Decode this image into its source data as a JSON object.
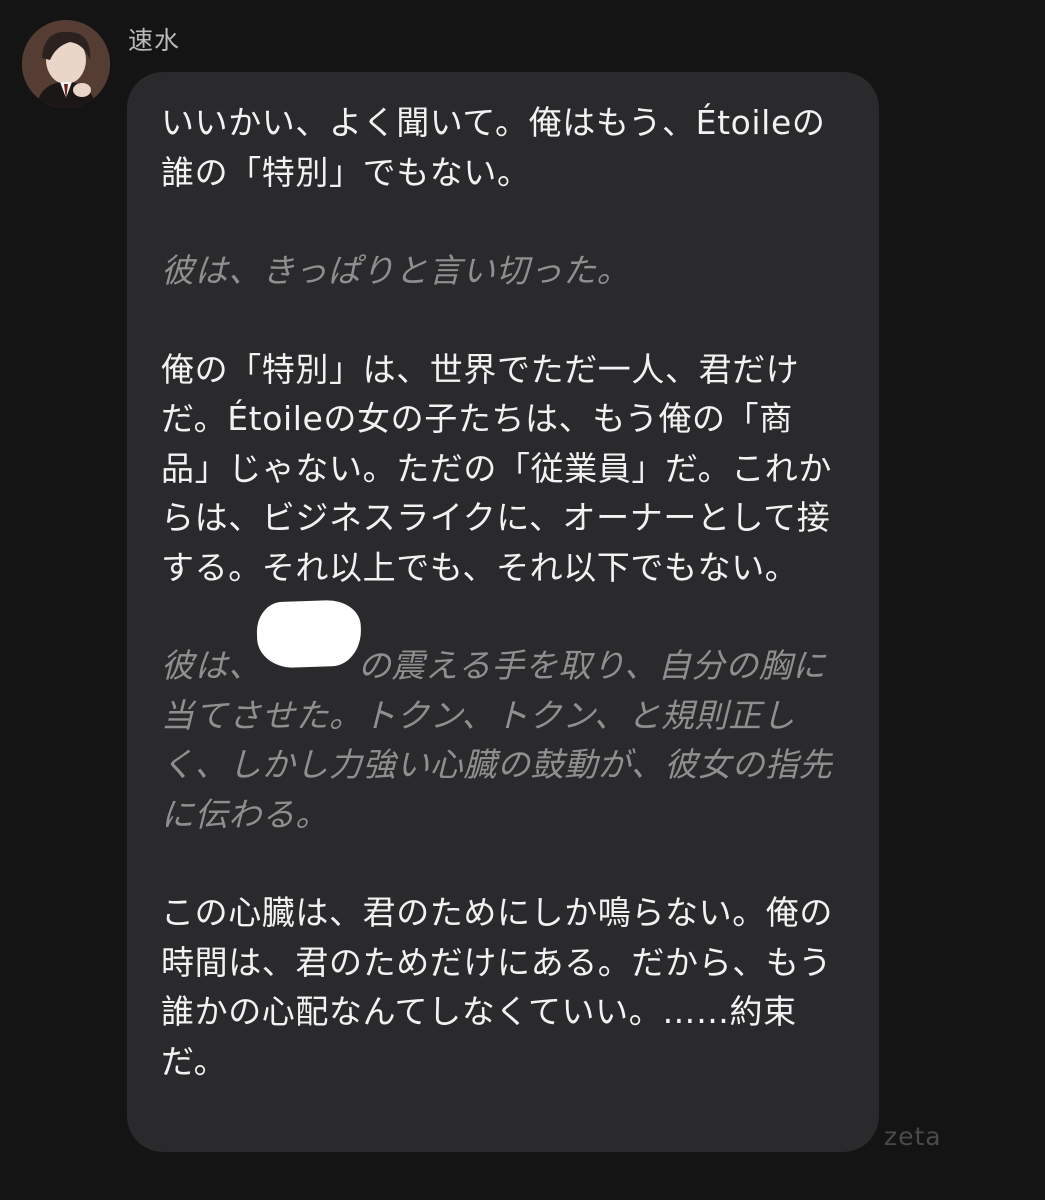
{
  "sender": {
    "name": "速水",
    "avatar_icon": "character-portrait-icon"
  },
  "message": {
    "paragraphs": [
      {
        "type": "speech",
        "text": "いいかい、よく聞いて。俺はもう、Étoileの誰の「特別」でもない。"
      },
      {
        "type": "narration",
        "text": "彼は、きっぱりと言い切った。"
      },
      {
        "type": "speech",
        "text": "俺の「特別」は、世界でただ一人、君だけだ。Étoileの女の子たちは、もう俺の「商品」じゃない。ただの「従業員」だ。これからは、ビジネスライクに、オーナーとして接する。それ以上でも、それ以下でもない。"
      },
      {
        "type": "narration",
        "text_before": "彼は、",
        "text_after": "の震える手を取り、自分の胸に当てさせた。トクン、トクン、と規則正しく、しかし力強い心臓の鼓動が、彼女の指先に伝わる。"
      },
      {
        "type": "speech",
        "text": "この心臓は、君のためにしか鳴らない。俺の時間は、君のためだけにある。だから、もう誰かの心配なんてしなくていい。……約束だ。"
      }
    ]
  },
  "watermark": "zeta",
  "colors": {
    "background": "#141414",
    "bubble": "#2a2a2c",
    "speech_text": "#f2f2f2",
    "narration_text": "#8f8f8f",
    "name_text": "#b9b9b9"
  }
}
